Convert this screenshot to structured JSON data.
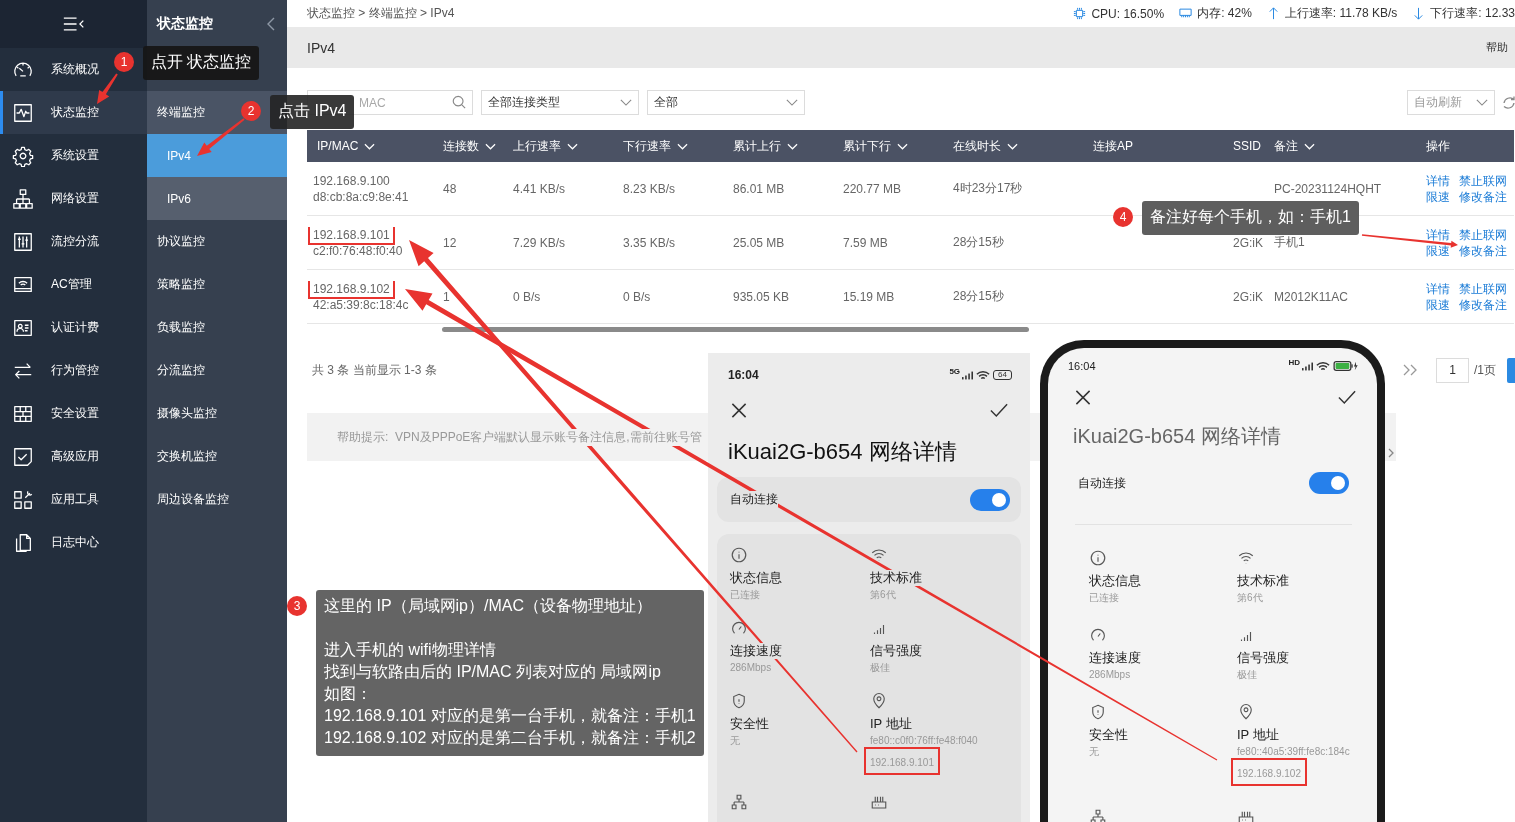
{
  "sidebar": {
    "items": [
      {
        "label": "系统概况",
        "selected": false
      },
      {
        "label": "状态监控",
        "selected": true
      },
      {
        "label": "系统设置",
        "selected": false
      },
      {
        "label": "网络设置",
        "selected": false
      },
      {
        "label": "流控分流",
        "selected": false
      },
      {
        "label": "AC管理",
        "selected": false
      },
      {
        "label": "认证计费",
        "selected": false
      },
      {
        "label": "行为管控",
        "selected": false
      },
      {
        "label": "安全设置",
        "selected": false
      },
      {
        "label": "高级应用",
        "selected": false
      },
      {
        "label": "应用工具",
        "selected": false
      },
      {
        "label": "日志中心",
        "selected": false
      }
    ]
  },
  "submenu": {
    "title": "状态监控",
    "items": [
      {
        "label": "终端监控",
        "selected": false,
        "expanded": true,
        "children": [
          {
            "label": "IPv4",
            "selected": true
          },
          {
            "label": "IPv6",
            "selected": false
          }
        ]
      },
      {
        "label": "协议监控",
        "selected": false,
        "expanded": false
      },
      {
        "label": "策略监控",
        "selected": false,
        "expanded": false
      },
      {
        "label": "负载监控",
        "selected": false,
        "expanded": false
      },
      {
        "label": "分流监控",
        "selected": false,
        "expanded": false
      },
      {
        "label": "摄像头监控",
        "selected": false,
        "expanded": false
      },
      {
        "label": "交换机监控",
        "selected": false,
        "expanded": false
      },
      {
        "label": "周边设备监控",
        "selected": false,
        "expanded": false
      }
    ]
  },
  "top_bar": {
    "breadcrumb": "状态监控 > 终端监控 > IPv4",
    "stats": [
      {
        "kind": "cpu",
        "text": "CPU: 16.50%"
      },
      {
        "kind": "memory",
        "text": "内存: 42%"
      },
      {
        "kind": "upload",
        "text": "上行速率: 11.78 KB/s"
      },
      {
        "kind": "download",
        "text": "下行速率: 12.33"
      }
    ]
  },
  "page_header": {
    "title": "IPv4",
    "help": "帮助"
  },
  "filters": {
    "search": {
      "placeholder": "MAC"
    },
    "selects": [
      "全部连接类型",
      "全部"
    ],
    "refresh_mode": "自动刷新"
  },
  "table": {
    "columns": [
      {
        "label": "IP/MAC",
        "sortable": true
      },
      {
        "label": "连接数",
        "sortable": true
      },
      {
        "label": "上行速率",
        "sortable": true
      },
      {
        "label": "下行速率",
        "sortable": true
      },
      {
        "label": "累计上行",
        "sortable": true
      },
      {
        "label": "累计下行",
        "sortable": true
      },
      {
        "label": "在线时长",
        "sortable": true
      },
      {
        "label": "连接AP",
        "sortable": false
      },
      {
        "label": "SSID",
        "sortable": false
      },
      {
        "label": "备注",
        "sortable": true
      },
      {
        "label": "操作",
        "sortable": false
      }
    ],
    "rows": [
      {
        "ip": "192.168.9.100",
        "mac": "d8:cb:8a:c9:8e:41",
        "highlighted": false,
        "connections": "48",
        "upload_rate": "4.41 KB/s",
        "download_rate": "8.23 KB/s",
        "total_up": "86.01 MB",
        "total_down": "220.77 MB",
        "online_time": "4时23分17秒",
        "remark": "PC-20231124HQHT",
        "actions": [
          "详情",
          "禁止联网",
          "限速",
          "修改备注"
        ]
      },
      {
        "ip": "192.168.9.101",
        "mac": "c2:f0:76:48:f0:40",
        "highlighted": true,
        "connections": "12",
        "upload_rate": "7.29 KB/s",
        "download_rate": "3.35 KB/s",
        "total_up": "25.05 MB",
        "total_down": "7.59 MB",
        "online_time": "28分15秒",
        "ssid": "2G:iK",
        "remark": "手机1",
        "actions": [
          "详情",
          "禁止联网",
          "限速",
          "修改备注"
        ]
      },
      {
        "ip": "192.168.9.102",
        "mac": "42:a5:39:8c:18:4c",
        "highlighted": true,
        "connections": "1",
        "upload_rate": "0 B/s",
        "download_rate": "0 B/s",
        "total_up": "935.05 KB",
        "total_down": "15.19 MB",
        "online_time": "28分15秒",
        "ssid": "2G:iK",
        "remark": "M2012K11AC",
        "actions": [
          "详情",
          "禁止联网",
          "限速",
          "修改备注"
        ]
      }
    ]
  },
  "summary": "共 3 条 当前显示 1-3 条",
  "pagination": {
    "page": "1",
    "total": "/1页"
  },
  "help_notice": {
    "text": "帮助提示:  VPN及PPPoE客户端默认显示账号备注信息,需前往账号管"
  },
  "phones": [
    {
      "kind": "screenshot",
      "time": "16:04",
      "network_label": "5G",
      "battery": "64",
      "title": "iKuai2G-b654 网络详情",
      "auto_connect": {
        "label": "自动连接",
        "on": true
      },
      "details": [
        {
          "kind": "info",
          "label": "状态信息",
          "value": "已连接"
        },
        {
          "kind": "wifi",
          "label": "技术标准",
          "value": "第6代"
        },
        {
          "kind": "speed",
          "label": "连接速度",
          "value": "286Mbps"
        },
        {
          "kind": "signal",
          "label": "信号强度",
          "value": "极佳"
        },
        {
          "kind": "shield",
          "label": "安全性",
          "value": "无"
        },
        {
          "kind": "ip",
          "label": "IP 地址",
          "value": "fe80::c0f0:76ff:fe48:f040",
          "ipv4": "192.168.9.101",
          "highlighted": true
        }
      ]
    },
    {
      "kind": "framed",
      "time": "16:04",
      "network_label": "HD",
      "title": "iKuai2G-b654 网络详情",
      "auto_connect": {
        "label": "自动连接",
        "on": true
      },
      "details": [
        {
          "kind": "info",
          "label": "状态信息",
          "value": "已连接"
        },
        {
          "kind": "wifi",
          "label": "技术标准",
          "value": "第6代"
        },
        {
          "kind": "speed",
          "label": "连接速度",
          "value": "286Mbps"
        },
        {
          "kind": "signal",
          "label": "信号强度",
          "value": "极佳"
        },
        {
          "kind": "shield",
          "label": "安全性",
          "value": "无"
        },
        {
          "kind": "ip",
          "label": "IP 地址",
          "value": "fe80::40a5:39ff:fe8c:184c",
          "ipv4": "192.168.9.102",
          "highlighted": true
        }
      ]
    }
  ],
  "annotations": [
    {
      "number": "1",
      "paragraphs": [
        [
          "点开 状态监控"
        ]
      ]
    },
    {
      "number": "2",
      "paragraphs": [
        [
          "点击 IPv4"
        ]
      ]
    },
    {
      "number": "3",
      "paragraphs": [
        [
          "这里的 IP（局域网ip）/MAC（设备物理地址）"
        ],
        [
          "进入手机的 wifi物理详情",
          "找到与软路由后的 IP/MAC 列表对应的 局域网ip",
          "如图：",
          "192.168.9.101 对应的是第一台手机，就备注：手机1",
          "192.168.9.102 对应的是第二台手机，就备注：手机2"
        ]
      ]
    },
    {
      "number": "4",
      "paragraphs": [
        [
          "备注好每个手机，如：手机1"
        ]
      ]
    }
  ]
}
